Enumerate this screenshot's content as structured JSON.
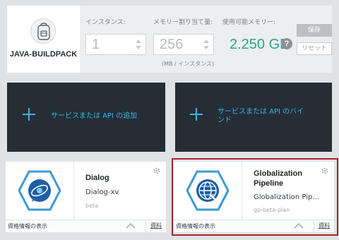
{
  "runtime": {
    "name": "JAVA-BUILDPACK",
    "instances_label": "インスタンス:",
    "instances_value": "1",
    "memory_label": "メモリー割り当て量:",
    "memory_value": "256",
    "memory_unit": "(MB / インスタンス)",
    "available_label": "使用可能メモリー:",
    "available_value": "2.250 GB",
    "help_glyph": "?",
    "save_label": "保存",
    "reset_label": "リセット"
  },
  "actions": {
    "add_service": "サービスまたは API の追加",
    "bind_service_line1": "サービスまたは API のバイ",
    "bind_service_line2": "ンド"
  },
  "services": [
    {
      "title": "Dialog",
      "subtitle": "Dialog-xv",
      "plan": "beta",
      "pricing_link": "資格情報の表示",
      "docs_link": "資料",
      "icon": "dialog-icon"
    },
    {
      "title_line1": "Globalization",
      "title_line2": "Pipeline",
      "subtitle": "Globalization Pip...",
      "plan": "gp-beta-plan",
      "pricing_link": "資格情報の表示",
      "docs_link": "資料",
      "icon": "globe-icon"
    }
  ],
  "colors": {
    "accent": "#3cb4e5",
    "memory_green": "#2aa68f",
    "tile_dark": "#252d35",
    "highlight": "#a8232b",
    "page_bg": "#dfe3e6"
  }
}
